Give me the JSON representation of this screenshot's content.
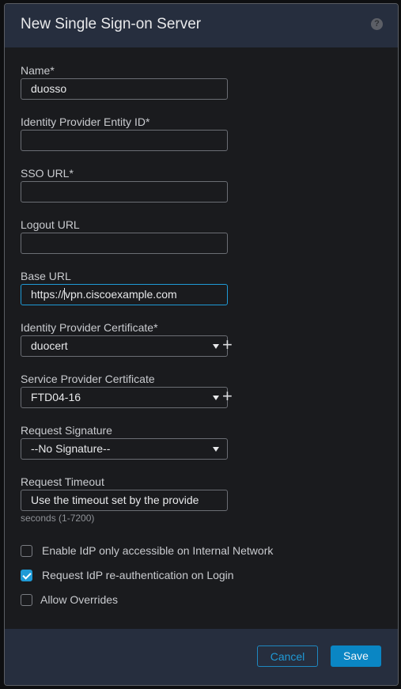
{
  "dialog": {
    "title": "New Single Sign-on Server",
    "help_icon": "?"
  },
  "fields": {
    "name": {
      "label": "Name*",
      "value": "duosso",
      "placeholder": ""
    },
    "entity_id": {
      "label": "Identity Provider Entity ID*",
      "value": "",
      "placeholder": ""
    },
    "sso_url": {
      "label": "SSO URL*",
      "value": "",
      "placeholder": ""
    },
    "logout_url": {
      "label": "Logout URL",
      "value": "",
      "placeholder": ""
    },
    "base_url": {
      "label": "Base URL",
      "value_before_caret": "https://",
      "value_after_caret": "vpn.ciscoexample.com"
    },
    "idp_cert": {
      "label": "Identity Provider Certificate*",
      "selected": "duocert",
      "add_icon": "+"
    },
    "sp_cert": {
      "label": "Service Provider Certificate",
      "selected": "FTD04-16",
      "add_icon": "+"
    },
    "request_signature": {
      "label": "Request Signature",
      "selected": "--No Signature--"
    },
    "request_timeout": {
      "label": "Request Timeout",
      "value": "Use the timeout set by the provide",
      "hint": "seconds (1-7200)"
    }
  },
  "checkboxes": [
    {
      "label": "Enable IdP only accessible on Internal Network",
      "checked": false
    },
    {
      "label": "Request IdP re-authentication on Login",
      "checked": true
    },
    {
      "label": "Allow Overrides",
      "checked": false
    }
  ],
  "footer": {
    "cancel_label": "Cancel",
    "save_label": "Save"
  },
  "colors": {
    "accent": "#1f9ad6",
    "header_bg": "#262e3e",
    "body_bg": "#1a1b1e"
  }
}
